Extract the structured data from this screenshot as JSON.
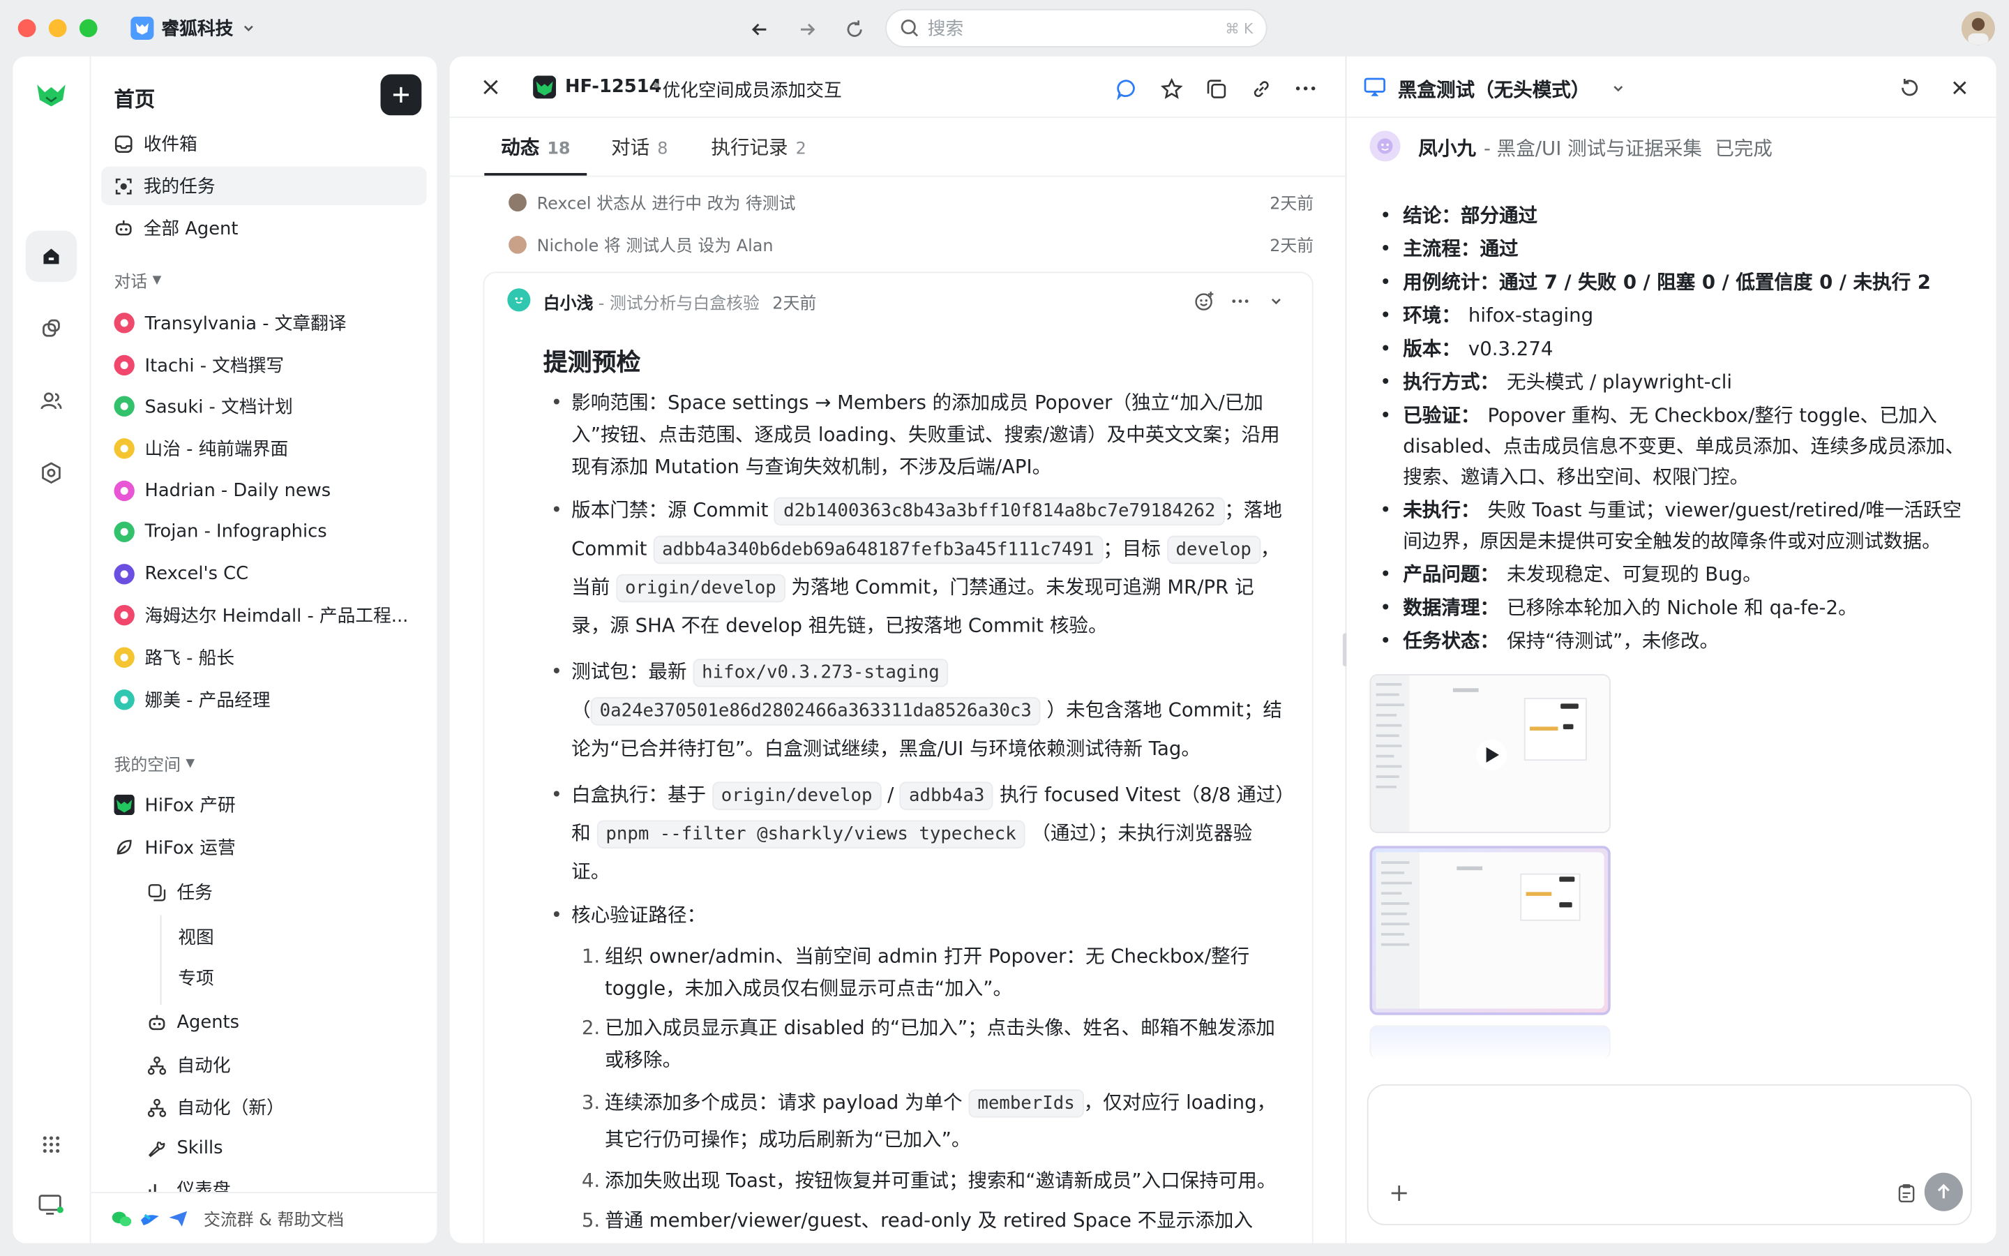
{
  "window": {
    "workspace_name": "睿狐科技"
  },
  "search": {
    "placeholder": "搜索",
    "shortcut": "⌘ K"
  },
  "sidebar": {
    "title": "首页",
    "top_items": [
      "收件箱",
      "我的任务",
      "全部 Agent"
    ],
    "conversations_label": "对话",
    "conversations": [
      {
        "label": "Transylvania - 文章翻译",
        "color": "#ef4a6b"
      },
      {
        "label": "Itachi - 文档撰写",
        "color": "#f2476d"
      },
      {
        "label": "Sasuki - 文档计划",
        "color": "#33c26b"
      },
      {
        "label": "山治 - 纯前端界面",
        "color": "#f5c531"
      },
      {
        "label": "Hadrian - Daily news",
        "color": "#e856d6"
      },
      {
        "label": "Trojan - Infographics",
        "color": "#33c26b"
      },
      {
        "label": "Rexcel's CC",
        "color": "#6b4fe0"
      },
      {
        "label": "海姆达尔 Heimdall - 产品工程...",
        "color": "#f2476d"
      },
      {
        "label": "路飞 - 船长",
        "color": "#f5c531"
      },
      {
        "label": "娜美 - 产品经理",
        "color": "#2fc7b0"
      }
    ],
    "spaces_label": "我的空间",
    "spaces": [
      "HiFox 产研",
      "HiFox 运营"
    ],
    "space_children": [
      "任务",
      "视图",
      "专项",
      "Agents",
      "自动化",
      "自动化（新）",
      "Skills",
      "仪表盘"
    ],
    "footer": "交流群 & 帮助文档"
  },
  "task": {
    "id": "HF-12514",
    "title": "优化空间成员添加交互",
    "tabs": [
      {
        "label": "动态",
        "count": "18"
      },
      {
        "label": "对话",
        "count": "8"
      },
      {
        "label": "执行记录",
        "count": "2"
      }
    ],
    "activities": [
      {
        "text": "Rexcel 状态从 进行中 改为 待测试",
        "time": "2天前"
      },
      {
        "text": "Nichole 将 测试人员 设为 Alan",
        "time": "2天前"
      }
    ],
    "comment": {
      "author": "白小浅",
      "skill": "- 测试分析与白盒核验",
      "time": "2天前",
      "heading": "提测预检",
      "b1": "影响范围：Space settings → Members 的添加成员 Popover（独立“加入/已加入”按钮、点击范围、逐成员 loading、失败重试、搜索/邀请）及中英文文案；沿用现有添加 Mutation 与查询失效机制，不涉及后端/API。",
      "b2_pre": "版本门禁：源 Commit",
      "b2_c1": "d2b1400363c8b43a3bff10f814a8bc7e79184262",
      "b2_mid1": "；落地 Commit",
      "b2_c2": "adbb4a340b6deb69a648187fefb3a45f111c7491",
      "b2_mid2": "；目标",
      "b2_c3": "develop",
      "b2_mid3": "，当前",
      "b2_c4": "origin/develop",
      "b2_post": "为落地 Commit，门禁通过。未发现可追溯 MR/PR 记录，源 SHA 不在 develop 祖先链，已按落地 Commit 核验。",
      "b3_pre": "测试包：最新",
      "b3_c1": "hifox/v0.3.273-staging",
      "b3_paren_open": "（",
      "b3_c2": "0a24e370501e86d2802466a363311da8526a30c3",
      "b3_post": "）未包含落地 Commit；结论为“已合并待打包”。白盒测试继续，黑盒/UI 与环境依赖测试待新 Tag。",
      "b4_pre": "白盒执行：基于",
      "b4_c1": "origin/develop",
      "b4_sep": "/",
      "b4_c2": "adbb4a3",
      "b4_mid": "执行 focused Vitest（8/8 通过）和",
      "b4_c3": "pnpm --filter @sharkly/views typecheck",
      "b4_post": "（通过）；未执行浏览器验证。",
      "b5": "核心验证路径：",
      "steps": [
        {
          "n": "1.",
          "text": "组织 owner/admin、当前空间 admin 打开 Popover：无 Checkbox/整行 toggle，未加入成员仅右侧显示可点击“加入”。"
        },
        {
          "n": "2.",
          "text": "已加入成员显示真正 disabled 的“已加入”；点击头像、姓名、邮箱不触发添加或移除。"
        },
        {
          "n": "3.",
          "pre": "连续添加多个成员：请求 payload 为单个",
          "code": "memberIds",
          "post": "，仅对应行 loading，其它行仍可操作；成功后刷新为“已加入”。"
        },
        {
          "n": "4.",
          "text": "添加失败出现 Toast，按钮恢复并可重试；搜索和“邀请新成员”入口保持可用。"
        },
        {
          "n": "5.",
          "text": "普通 member/viewer/guest、read-only 及 retired Space 不显示添加入口；"
        }
      ]
    }
  },
  "right_panel": {
    "title": "黑盒测试（无头模式）",
    "agent": "凤小九",
    "skill": "- 黑盒/UI 测试与证据采集",
    "status": "已完成",
    "results": [
      {
        "k": "结论：",
        "v": "部分通过",
        "bold": true
      },
      {
        "k": "主流程：",
        "v": "通过",
        "bold": true
      },
      {
        "k": "用例统计：",
        "v": "通过 7 / 失败 0 / 阻塞 0 / 低置信度 0 / 未执行 2",
        "bold": true
      },
      {
        "k": "环境：",
        "v": "hifox-staging"
      },
      {
        "k": "版本：",
        "v": "v0.3.274"
      },
      {
        "k": "执行方式：",
        "v": "无头模式 / playwright-cli"
      },
      {
        "k": "已验证：",
        "v": "Popover 重构、无 Checkbox/整行 toggle、已加入 disabled、点击成员信息不变更、单成员添加、连续多成员添加、搜索、邀请入口、移出空间、权限门控。"
      },
      {
        "k": "未执行：",
        "v": "失败 Toast 与重试；viewer/guest/retired/唯一活跃空间边界，原因是未提供可安全触发的故障条件或对应测试数据。"
      },
      {
        "k": "产品问题：",
        "v": "未发现稳定、可复现的 Bug。"
      },
      {
        "k": "数据清理：",
        "v": "已移除本轮加入的 Nichole 和 qa-fe-2。"
      },
      {
        "k": "任务状态：",
        "v": "保持“待测试”，未修改。"
      }
    ]
  },
  "colors": {
    "brand": "#22c55e",
    "accent": "#4e9bff",
    "dark": "#1f2328"
  }
}
